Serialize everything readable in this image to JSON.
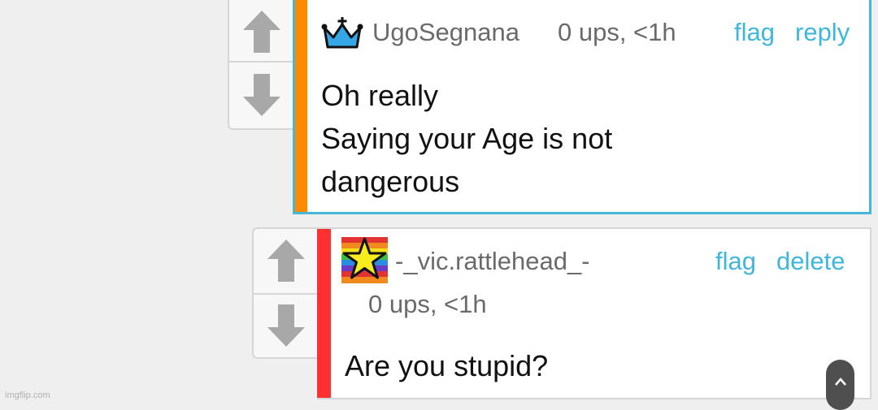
{
  "comments": [
    {
      "username": "UgoSegnana",
      "meta": "0 ups, <1h",
      "actions": [
        "flag",
        "reply"
      ],
      "body_lines": [
        "Oh really",
        "Saying your Age is not",
        "dangerous"
      ],
      "stripe_color": "#ff8a00",
      "border_color": "#45b8d8",
      "badge_icon": "crown-icon"
    },
    {
      "username": "-_vic.rattlehead_-",
      "meta": "0 ups, <1h",
      "actions": [
        "flag",
        "delete"
      ],
      "body_lines": [
        "Are you stupid?"
      ],
      "stripe_color": "#ff3030",
      "badge_icon": "rainbow-star-icon"
    }
  ],
  "watermark": "imgflip.com",
  "colors": {
    "link": "#3fb7dd",
    "vote_arrow": "#a8a8a8"
  }
}
